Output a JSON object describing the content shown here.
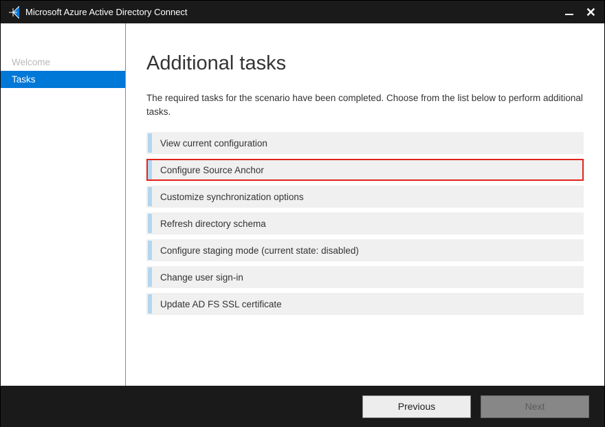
{
  "titlebar": {
    "title": "Microsoft Azure Active Directory Connect"
  },
  "sidebar": {
    "items": [
      {
        "label": "Welcome",
        "active": false
      },
      {
        "label": "Tasks",
        "active": true
      }
    ]
  },
  "main": {
    "heading": "Additional tasks",
    "description": "The required tasks for the scenario have been completed. Choose from the list below to perform additional tasks.",
    "tasks": [
      {
        "label": "View current configuration",
        "highlighted": false
      },
      {
        "label": "Configure Source Anchor",
        "highlighted": true
      },
      {
        "label": "Customize synchronization options",
        "highlighted": false
      },
      {
        "label": "Refresh directory schema",
        "highlighted": false
      },
      {
        "label": "Configure staging mode (current state: disabled)",
        "highlighted": false
      },
      {
        "label": "Change user sign-in",
        "highlighted": false
      },
      {
        "label": "Update AD FS SSL certificate",
        "highlighted": false
      }
    ]
  },
  "footer": {
    "previous_label": "Previous",
    "next_label": "Next"
  }
}
